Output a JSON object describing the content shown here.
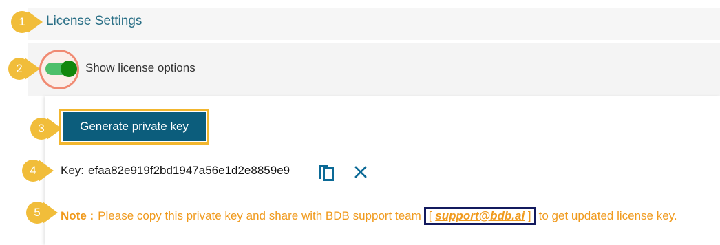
{
  "section": {
    "title": "License Settings"
  },
  "toggle": {
    "label": "Show license options",
    "on": true
  },
  "actions": {
    "generate_label": "Generate private key"
  },
  "key": {
    "label": "Key:",
    "value": "efaa82e919f2bd1947a56e1d2e8859e9"
  },
  "note": {
    "label": "Note :",
    "text_before": "Please copy this private key and share with BDB support team",
    "bracket_open": "[",
    "email": "support@bdb.ai",
    "bracket_close": "]",
    "text_after": "to get updated license key."
  },
  "markers": [
    "1",
    "2",
    "3",
    "4",
    "5"
  ],
  "colors": {
    "accent": "#0c5d7c",
    "title": "#2a6f86",
    "marker": "#f1bd3a",
    "toggle_on": "#12870d",
    "note": "#f09a1d",
    "highlight_border": "#f2b62e",
    "email_box": "#131a5e"
  },
  "icons": {
    "copy": "copy-icon",
    "close": "close-icon"
  }
}
